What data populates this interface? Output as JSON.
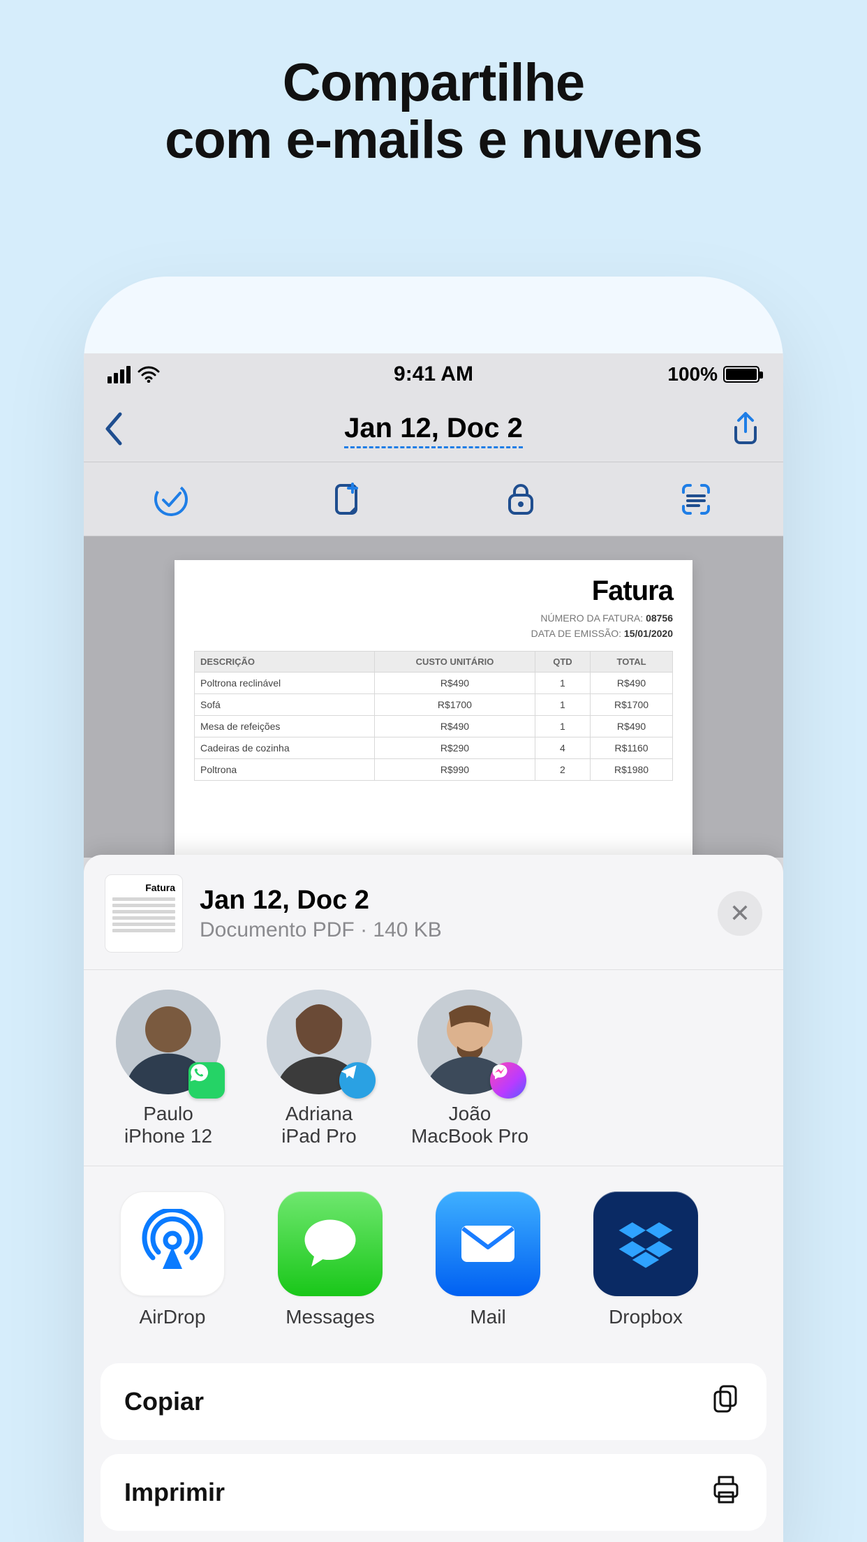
{
  "promo": {
    "line1": "Compartilhe",
    "line2": "com e-mails e nuvens"
  },
  "status": {
    "time": "9:41 AM",
    "battery_text": "100%"
  },
  "nav": {
    "title": "Jan 12, Doc 2"
  },
  "toolbar": {
    "check_icon": "check-circle",
    "addpage_icon": "add-page",
    "lock_icon": "lock",
    "ocr_icon": "ocr-scan"
  },
  "invoice": {
    "title": "Fatura",
    "number_label": "NÚMERO DA FATURA:",
    "number": "08756",
    "date_label": "DATA DE EMISSÃO:",
    "date": "15/01/2020",
    "cols": [
      "DESCRIÇÃO",
      "CUSTO UNITÁRIO",
      "QTD",
      "TOTAL"
    ],
    "rows": [
      [
        "Poltrona reclinável",
        "R$490",
        "1",
        "R$490"
      ],
      [
        "Sofá",
        "R$1700",
        "1",
        "R$1700"
      ],
      [
        "Mesa de refeições",
        "R$490",
        "1",
        "R$490"
      ],
      [
        "Cadeiras de cozinha",
        "R$290",
        "4",
        "R$1160"
      ],
      [
        "Poltrona",
        "R$990",
        "2",
        "R$1980"
      ]
    ]
  },
  "share": {
    "doc_title": "Jan 12, Doc 2",
    "doc_subtitle": "Documento PDF  · 140 KB",
    "thumb_title": "Fatura",
    "close_label": "✕",
    "contacts": [
      {
        "name": "Paulo",
        "device": "iPhone 12",
        "badge": "whatsapp"
      },
      {
        "name": "Adriana",
        "device": "iPad Pro",
        "badge": "telegram"
      },
      {
        "name": "João",
        "device": "MacBook Pro",
        "badge": "messenger"
      }
    ],
    "apps": [
      {
        "label": "AirDrop",
        "icon": "airdrop"
      },
      {
        "label": "Messages",
        "icon": "messages"
      },
      {
        "label": "Mail",
        "icon": "mail"
      },
      {
        "label": "Dropbox",
        "icon": "dropbox"
      }
    ],
    "actions": [
      {
        "label": "Copiar",
        "icon": "copy"
      },
      {
        "label": "Imprimir",
        "icon": "print"
      }
    ]
  },
  "colors": {
    "accent_blue": "#1f7ee6",
    "toolbar_blue": "#1f4e8f"
  }
}
